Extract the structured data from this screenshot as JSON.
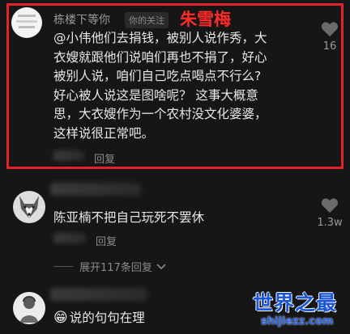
{
  "comments": [
    {
      "username": "栋楼下等你",
      "tag": "你的关注",
      "annotation": "朱雪梅",
      "lines": [
        "@小伟他们去捐钱，被别人说作秀，大",
        "衣嫂就跟他们说咱们再也不捐了，好心",
        "被别人说，咱们自己吃点喝点不行么?",
        "好心被人说这是图啥呢？ 这事大概意",
        "思，大衣嫂作为一个农村没文化婆婆，",
        "这样说很正常吧。"
      ],
      "reply_label": "回复",
      "like_count": "16"
    },
    {
      "text": "陈亚楠不把自己玩死不罢休",
      "reply_label": "回复",
      "like_count": "1.3w"
    },
    {
      "emoji": "😁",
      "text": "说的句句在理"
    }
  ],
  "expand": {
    "label": "展开117条回复",
    "icon": "chevron-down-icon"
  },
  "watermark": {
    "title": "世界之最",
    "url": "shijiezz.com"
  },
  "colors": {
    "background": "#161616",
    "annotation_red": "#e3222b",
    "watermark_blue": "#1a55d8"
  }
}
